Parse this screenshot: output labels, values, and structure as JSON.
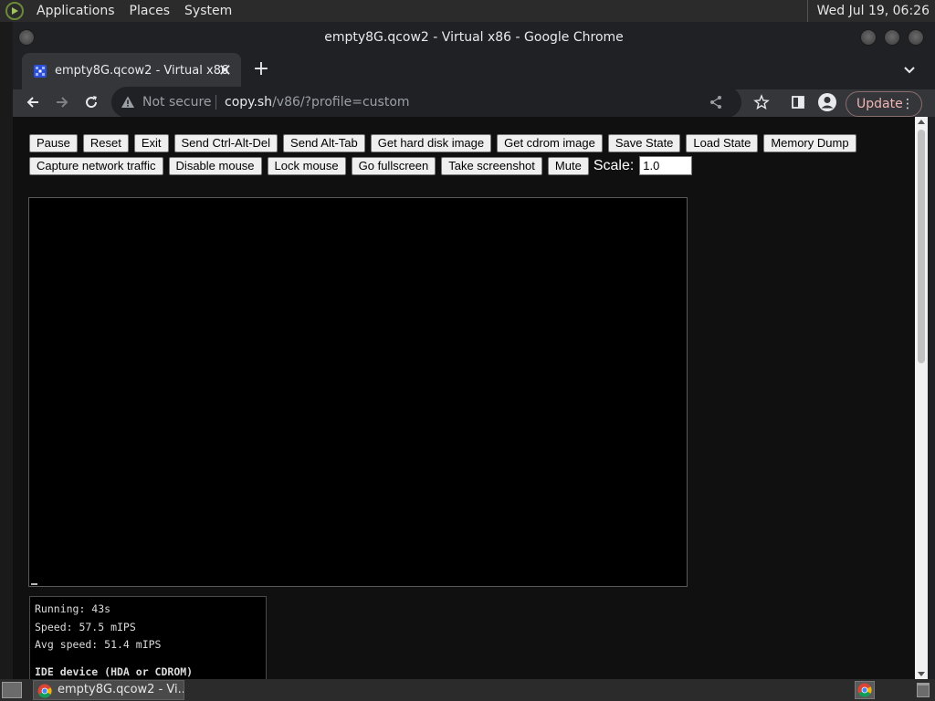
{
  "top_panel": {
    "menus": [
      "Applications",
      "Places",
      "System"
    ],
    "clock": "Wed Jul 19, 06:26"
  },
  "window": {
    "title": "empty8G.qcow2 - Virtual x86 - Google Chrome"
  },
  "tab": {
    "title": "empty8G.qcow2 - Virtual x86",
    "close": "✕",
    "new_tab": "+"
  },
  "omnibox": {
    "security": "Not secure",
    "url_host": "copy.sh",
    "url_path": "/v86/?profile=custom"
  },
  "toolbar": {
    "update_label": "Update",
    "menu_dots": "⋮"
  },
  "controls": {
    "row1": [
      "Pause",
      "Reset",
      "Exit",
      "Send Ctrl-Alt-Del",
      "Send Alt-Tab",
      "Get hard disk image",
      "Get cdrom image",
      "Save State",
      "Load State",
      "Memory Dump"
    ],
    "row2": [
      "Capture network traffic",
      "Disable mouse",
      "Lock mouse",
      "Go fullscreen",
      "Take screenshot",
      "Mute"
    ],
    "scale_label": "Scale:",
    "scale_value": "1.0"
  },
  "stats": {
    "running": "Running: 43s",
    "speed": "Speed: 57.5 mIPS",
    "avg_speed": "Avg speed: 51.4 mIPS",
    "ide_header": "IDE device (HDA or CDROM)"
  },
  "taskbar": {
    "task_title": "empty8G.qcow2 - Vi..."
  },
  "colors": {
    "page_bg": "#101010",
    "chrome_dark": "#202124",
    "chrome_toolbar": "#35363a",
    "update_accent": "#f0b4b4"
  }
}
